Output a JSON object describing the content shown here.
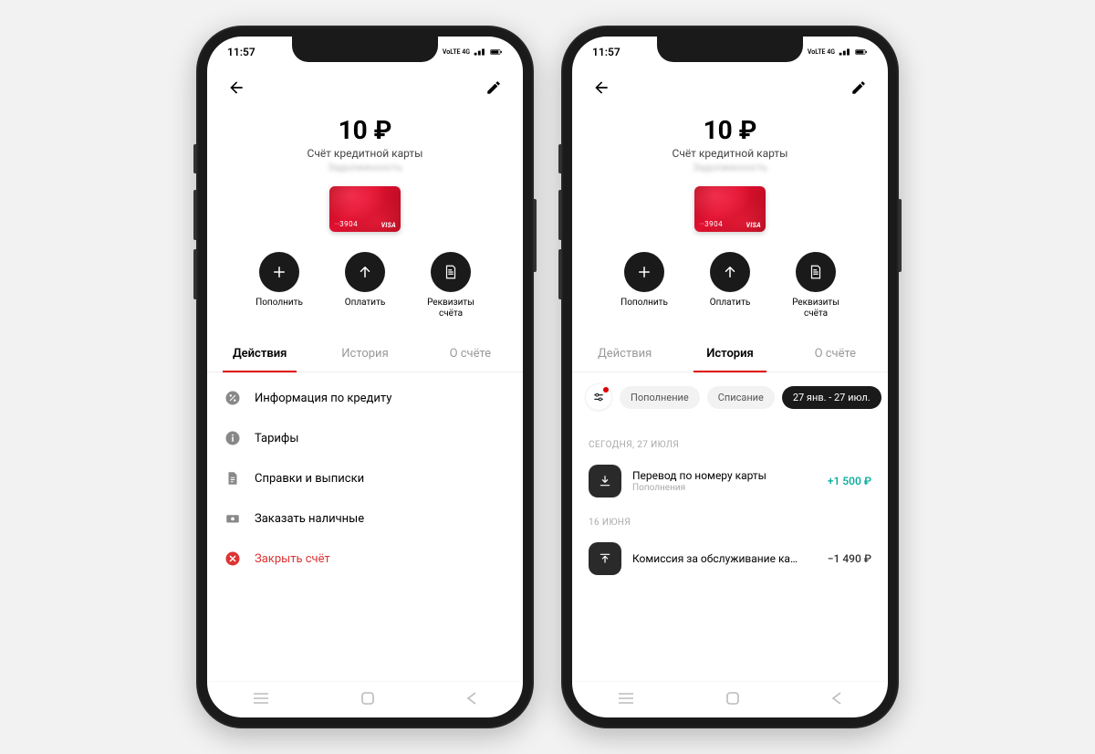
{
  "status": {
    "time": "11:57",
    "net": "VoLTE 4G"
  },
  "balance": {
    "amount": "10 ₽",
    "sub1": "Счёт кредитной карты",
    "sub2": "Задолженность"
  },
  "card": {
    "last4": "··3904",
    "brand": "VISA"
  },
  "quick": {
    "topup": "Пополнить",
    "pay": "Оплатить",
    "details": "Реквизиты\nсчёта"
  },
  "tabs": {
    "actions": "Действия",
    "history": "История",
    "about": "О счёте"
  },
  "actions_list": {
    "info": "Информация по кредиту",
    "tariffs": "Тарифы",
    "statements": "Справки и выписки",
    "cash": "Заказать наличные",
    "close": "Закрыть счёт"
  },
  "filters": {
    "topup": "Пополнение",
    "debit": "Списание",
    "range": "27 янв. - 27 июл."
  },
  "history": {
    "today_label": "Сегодня, 27 июля",
    "tx1_title": "Перевод по номеру карты",
    "tx1_sub": "Пополнения",
    "tx1_amt": "+1 500 ₽",
    "june_label": "16 июня",
    "tx2_title": "Комиссия за обслуживание ка…",
    "tx2_amt": "−1 490 ₽"
  }
}
